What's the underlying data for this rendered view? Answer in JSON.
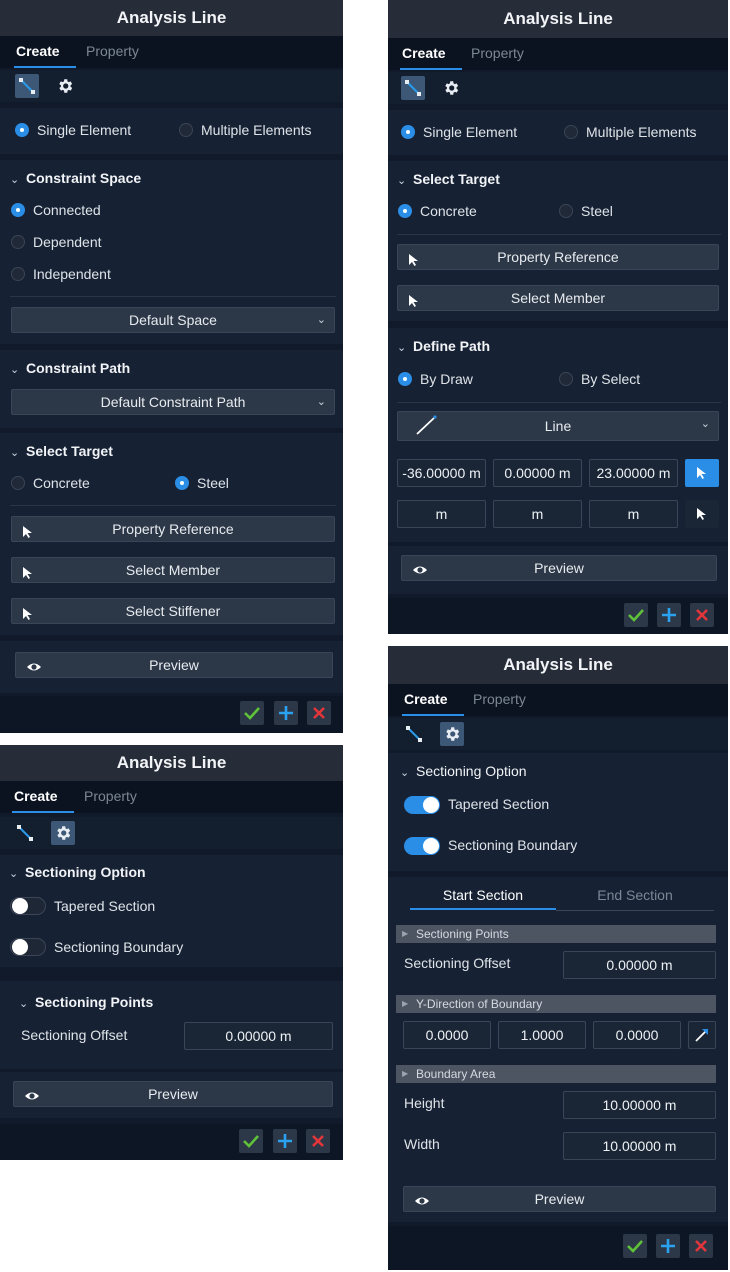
{
  "panel1": {
    "title": "Analysis Line",
    "tabs": {
      "create": "Create",
      "property": "Property"
    },
    "mode": {
      "single": "Single Element",
      "multiple": "Multiple Elements"
    },
    "constraint_space": {
      "header": "Constraint Space",
      "connected": "Connected",
      "dependent": "Dependent",
      "independent": "Independent",
      "dropdown": "Default Space"
    },
    "constraint_path": {
      "header": "Constraint Path",
      "dropdown": "Default Constraint Path"
    },
    "select_target": {
      "header": "Select Target",
      "concrete": "Concrete",
      "steel": "Steel",
      "property_reference": "Property Reference",
      "select_member": "Select Member",
      "select_stiffener": "Select Stiffener"
    },
    "preview": "Preview"
  },
  "panel2": {
    "title": "Analysis Line",
    "tabs": {
      "create": "Create",
      "property": "Property"
    },
    "mode": {
      "single": "Single Element",
      "multiple": "Multiple Elements"
    },
    "select_target": {
      "header": "Select Target",
      "concrete": "Concrete",
      "steel": "Steel",
      "property_reference": "Property Reference",
      "select_member": "Select Member"
    },
    "define_path": {
      "header": "Define Path",
      "by_draw": "By Draw",
      "by_select": "By Select",
      "shape": "Line",
      "row1": [
        "-36.00000 m",
        "0.00000 m",
        "23.00000 m"
      ],
      "row2": [
        "m",
        "m",
        "m"
      ]
    },
    "preview": "Preview"
  },
  "panel3": {
    "title": "Analysis Line",
    "tabs": {
      "create": "Create",
      "property": "Property"
    },
    "sectioning_option": {
      "header": "Sectioning Option",
      "tapered": "Tapered Section",
      "boundary": "Sectioning Boundary"
    },
    "sectioning_points": {
      "header": "Sectioning Points",
      "offset_label": "Sectioning Offset",
      "offset_value": "0.00000 m"
    },
    "preview": "Preview"
  },
  "panel4": {
    "title": "Analysis Line",
    "tabs": {
      "create": "Create",
      "property": "Property"
    },
    "sectioning_option": {
      "header": "Sectioning Option",
      "tapered": "Tapered Section",
      "boundary": "Sectioning Boundary"
    },
    "section_tabs": {
      "start": "Start Section",
      "end": "End Section"
    },
    "sectioning_points": {
      "header": "Sectioning Points",
      "offset_label": "Sectioning Offset",
      "offset_value": "0.00000 m"
    },
    "y_direction": {
      "header": "Y-Direction of Boundary",
      "values": [
        "0.0000",
        "1.0000",
        "0.0000"
      ]
    },
    "boundary_area": {
      "header": "Boundary Area",
      "height_label": "Height",
      "height_value": "10.00000 m",
      "width_label": "Width",
      "width_value": "10.00000 m"
    },
    "preview": "Preview"
  },
  "icons": {
    "line_tool": "diagonal-line-icon",
    "settings": "gear-icon",
    "pointer": "cursor-arrow-icon",
    "eye": "eye-icon",
    "confirm": "check-icon",
    "add": "plus-icon",
    "cancel": "close-icon"
  },
  "colors": {
    "accent": "#2b8ee6",
    "confirm": "#5fc238",
    "add": "#2ba2f0",
    "cancel": "#e4353a",
    "panel_bg": "#101a2a",
    "title_bg": "#262c38"
  }
}
